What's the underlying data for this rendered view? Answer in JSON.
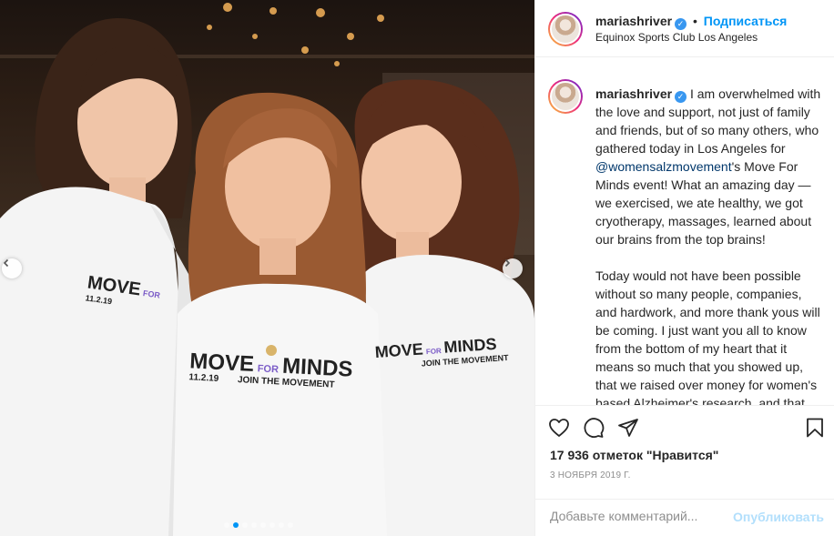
{
  "post": {
    "username": "mariashriver",
    "verified_mark": "✓",
    "separator": "•",
    "follow_label": "Подписаться",
    "location": "Equinox Sports Club Los Angeles",
    "caption": {
      "username": "mariashriver",
      "part1": " I am overwhelmed with the love and support, not just of family and friends, but of so many others, who gathered today in Los Angeles for ",
      "mention": "@womensalzmovement",
      "part2": "'s Move For Minds event! What an amazing day — we exercised, we ate healthy, we got cryotherapy, massages, learned about our brains from the top brains!",
      "paragraph2": "Today would not have been possible without so many people, companies, and hardwork, and more thank yous will be coming. I just want you all to know from the bottom of my heart that it means so much that you showed up, that we raised over money for women's based Alzheimer's research, and that we all are making a difference."
    },
    "likes": "17 936 отметок \"Нравится\"",
    "date": "3 НОЯБРЯ 2019 Г.",
    "comment_placeholder": "Добавьте комментарий...",
    "post_button": "Опубликовать"
  },
  "photo": {
    "shirt_word1": "MOVE",
    "shirt_for": "FOR",
    "shirt_word2": "MINDS",
    "shirt_date": "11.2.19",
    "shirt_tagline": "JOIN THE MOVEMENT",
    "carousel_count": 8,
    "carousel_active_index": 1
  },
  "icons": {
    "nav_prev": "chevron-left-icon",
    "nav_next": "chevron-right-icon",
    "like": "heart-icon",
    "comment": "comment-icon",
    "share": "paper-plane-icon",
    "save": "bookmark-icon"
  },
  "colors": {
    "accent": "#0095f6",
    "text": "#262626",
    "muted": "#8e8e8e",
    "mention": "#00376b",
    "post_disabled": "#b2dffc",
    "shirt_purple": "#7b5cc7"
  }
}
